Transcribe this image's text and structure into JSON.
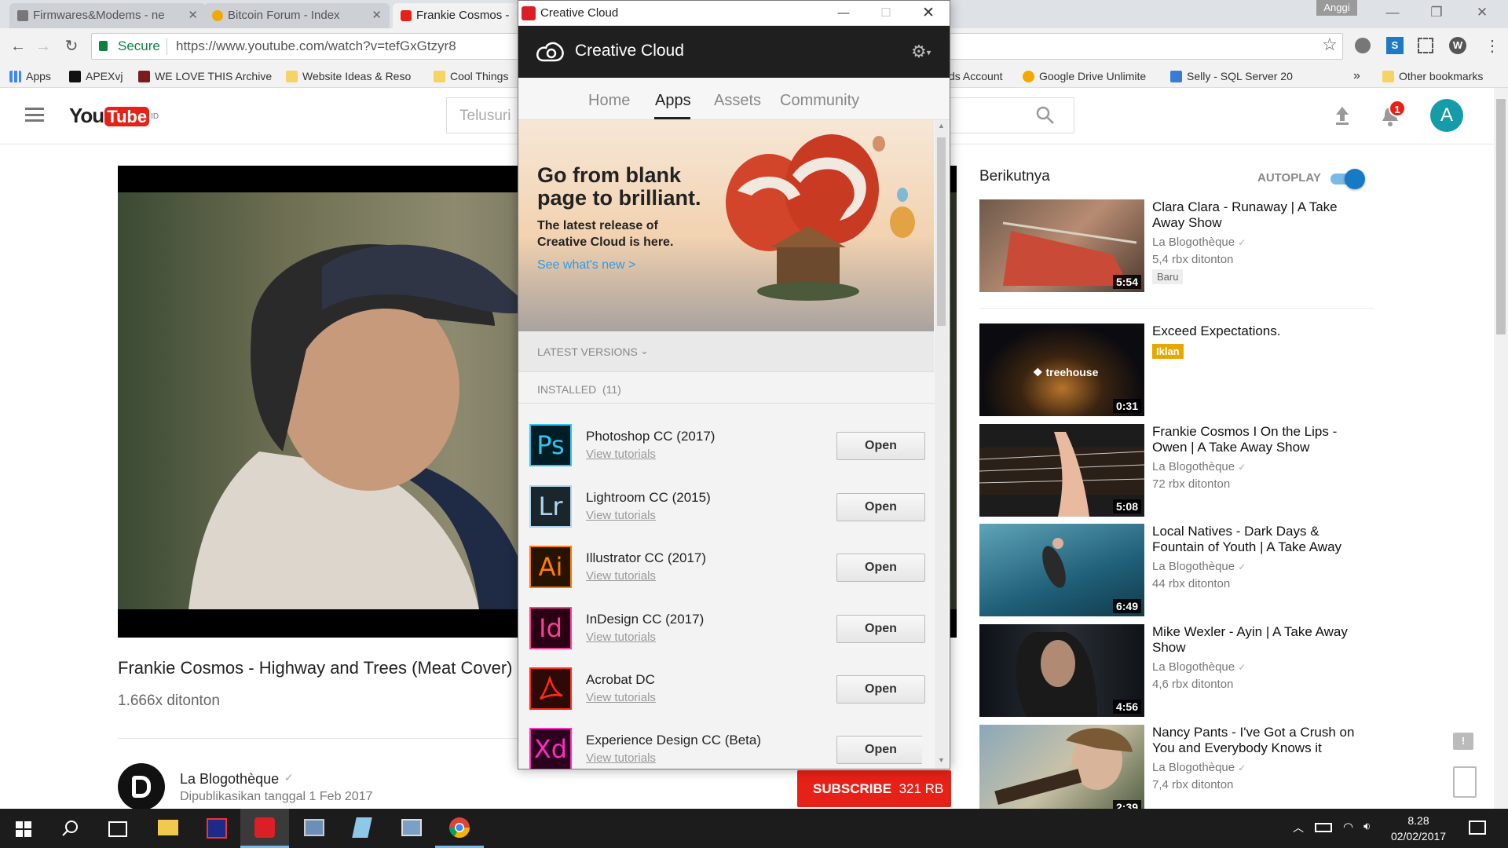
{
  "browser": {
    "tabs": [
      {
        "label": "Firmwares&Modems - ne",
        "icon": "folder-icon"
      },
      {
        "label": "Bitcoin Forum - Index",
        "icon": "bitcoin-icon"
      },
      {
        "label": "Frankie Cosmos - ",
        "icon": "youtube-icon"
      }
    ],
    "user_chip": "Anggi",
    "secure_label": "Secure",
    "url": "https://www.youtube.com/watch?v=tefGxGtzyr8",
    "bookmarks": [
      {
        "label": "Apps",
        "icon": "apps-grid-icon"
      },
      {
        "label": "APEXvj",
        "icon": "apexvj-icon"
      },
      {
        "label": "WE LOVE THIS Archive",
        "icon": "archive-icon"
      },
      {
        "label": "Website Ideas & Reso",
        "icon": "folder-icon"
      },
      {
        "label": "Cool Things",
        "icon": "folder-icon"
      },
      {
        "label": "ds Account",
        "icon": "page-icon"
      },
      {
        "label": "Google Drive Unlimite",
        "icon": "gdrive-icon"
      },
      {
        "label": "Selly - SQL Server 20",
        "icon": "selly-icon"
      },
      {
        "label": "»",
        "icon": "more-icon"
      },
      {
        "label": "Other bookmarks",
        "icon": "folder-icon"
      }
    ]
  },
  "youtube": {
    "logo_text": "You",
    "logo_tube": "Tube",
    "logo_region": "ID",
    "search_placeholder": "Telusuri",
    "notifications_count": "1",
    "avatar_letter": "A",
    "video_title": "Frankie Cosmos - Highway and Trees (Meat Cover)",
    "views": "1.666x ditonton",
    "channel": "La Blogothèque",
    "published": "Dipublikasikan tanggal 1 Feb 2017",
    "subscribe_label": "SUBSCRIBE",
    "subscribe_count": "321 RB",
    "up_next": "Berikutnya",
    "autoplay": "AUTOPLAY",
    "autoplay_on": true,
    "recommendations": [
      {
        "title": "Clara Clara - Runaway | A Take Away Show",
        "channel": "La Blogothèque",
        "views": "5,4 rbx ditonton",
        "badge": "Baru",
        "duration": "5:54"
      },
      {
        "title": "Exceed Expectations.",
        "channel": "",
        "views": "",
        "badge": "Iklan",
        "duration": "0:31",
        "thumb_text": "treehouse"
      },
      {
        "title": "Frankie Cosmos I On the Lips - Owen | A Take Away Show",
        "channel": "La Blogothèque",
        "views": "72 rbx ditonton",
        "badge": "",
        "duration": "5:08"
      },
      {
        "title": "Local Natives - Dark Days & Fountain of Youth | A Take Away",
        "channel": "La Blogothèque",
        "views": "44 rbx ditonton",
        "badge": "",
        "duration": "6:49"
      },
      {
        "title": "Mike Wexler - Ayin | A Take Away Show",
        "channel": "La Blogothèque",
        "views": "4,6 rbx ditonton",
        "badge": "",
        "duration": "4:56"
      },
      {
        "title": "Nancy Pants - I've Got a Crush on You and Everybody Knows it",
        "channel": "La Blogothèque",
        "views": "7,4 rbx ditonton",
        "badge": "",
        "duration": "2:39"
      }
    ]
  },
  "cc": {
    "window_title": "Creative Cloud",
    "header_title": "Creative Cloud",
    "nav": [
      "Home",
      "Apps",
      "Assets",
      "Community"
    ],
    "active_nav": "Apps",
    "banner_headline_1": "Go from blank",
    "banner_headline_2": "page to brilliant.",
    "banner_sub_1": "The latest release of",
    "banner_sub_2": "Creative Cloud is here.",
    "banner_link": "See what's new >",
    "latest_versions": "LATEST VERSIONS",
    "installed": "INSTALLED  (11)",
    "open_label": "Open",
    "tutorials_label": "View tutorials",
    "apps": [
      {
        "abbr": "Ps",
        "name": "Photoshop CC (2017)",
        "fg": "#31c5f0",
        "bg": "#001d26"
      },
      {
        "abbr": "Lr",
        "name": "Lightroom CC (2015)",
        "fg": "#add5ec",
        "bg": "#1b262c"
      },
      {
        "abbr": "Ai",
        "name": "Illustrator CC (2017)",
        "fg": "#ff7c00",
        "bg": "#261300"
      },
      {
        "abbr": "Id",
        "name": "InDesign CC (2017)",
        "fg": "#ff3f94",
        "bg": "#2a0014"
      },
      {
        "abbr": "",
        "name": "Acrobat DC",
        "fg": "#ff2a1a",
        "bg": "#2d0a05"
      },
      {
        "abbr": "Xd",
        "name": "Experience Design CC (Beta)",
        "fg": "#ff2bc2",
        "bg": "#2e001f"
      }
    ]
  },
  "taskbar": {
    "time": "8.28",
    "date": "02/02/2017"
  },
  "colors": {
    "yt_red": "#e62117",
    "cc_header": "#1f1f1f",
    "link_blue": "#2d9ae8",
    "autoplay_blue": "#167ac6"
  }
}
